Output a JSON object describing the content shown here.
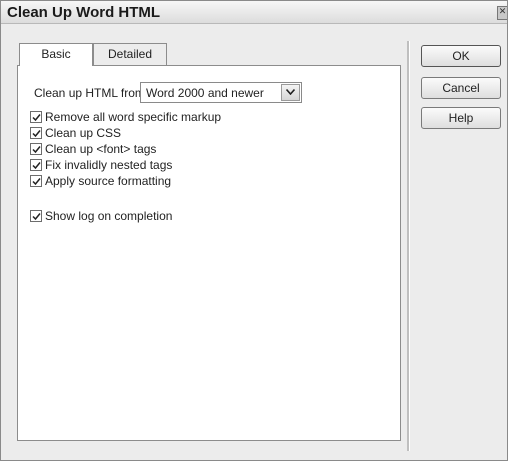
{
  "window": {
    "title": "Clean Up Word HTML"
  },
  "tabs": [
    {
      "label": "Basic"
    },
    {
      "label": "Detailed"
    }
  ],
  "basic": {
    "cleanup_from_label": "Clean up HTML from",
    "cleanup_from_value": "Word 2000 and newer",
    "options": [
      {
        "label": "Remove all word specific markup",
        "checked": true
      },
      {
        "label": "Clean up CSS",
        "checked": true
      },
      {
        "label": "Clean up <font> tags",
        "checked": true
      },
      {
        "label": "Fix invalidly nested tags",
        "checked": true
      },
      {
        "label": "Apply source formatting",
        "checked": true
      }
    ],
    "show_log": {
      "label": "Show log on completion",
      "checked": true
    }
  },
  "buttons": {
    "ok": "OK",
    "cancel": "Cancel",
    "help": "Help"
  }
}
